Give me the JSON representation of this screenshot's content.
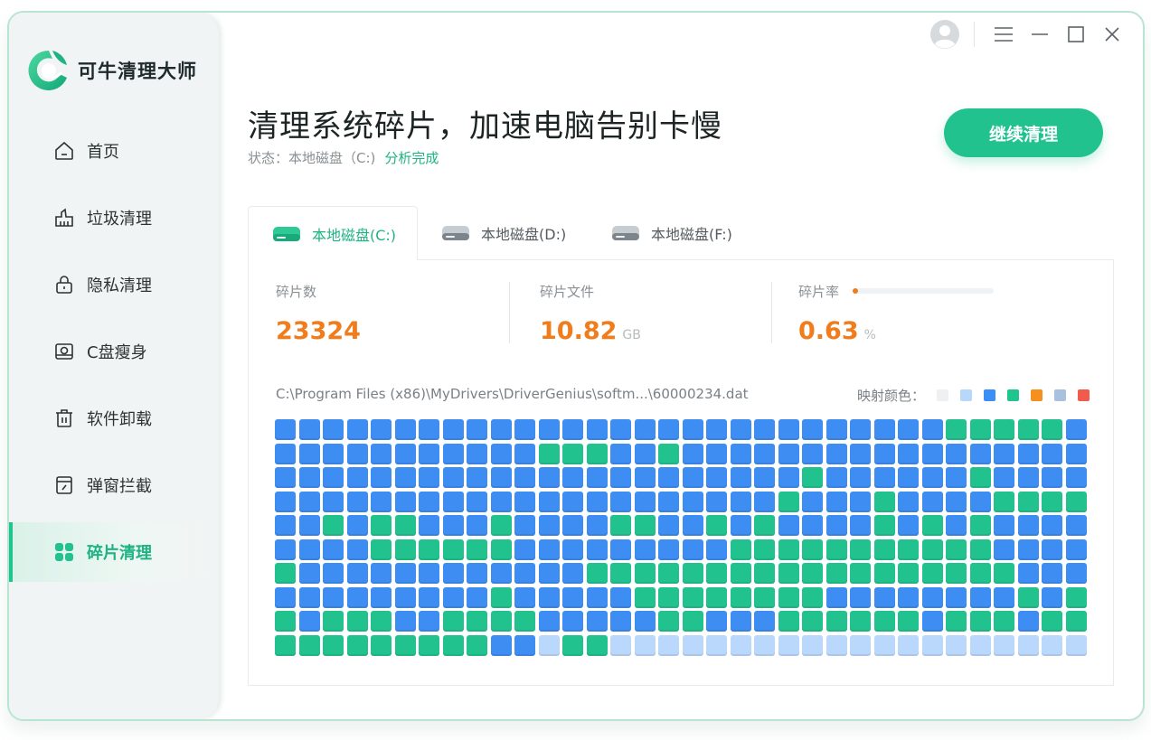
{
  "app": {
    "name": "可牛清理大师"
  },
  "sidebar": {
    "items": [
      {
        "label": "首页",
        "icon": "home-icon",
        "active": false
      },
      {
        "label": "垃圾清理",
        "icon": "trash-bin-icon",
        "active": false
      },
      {
        "label": "隐私清理",
        "icon": "lock-icon",
        "active": false
      },
      {
        "label": "C盘瘦身",
        "icon": "disk-slim-icon",
        "active": false
      },
      {
        "label": "软件卸载",
        "icon": "uninstall-icon",
        "active": false
      },
      {
        "label": "弹窗拦截",
        "icon": "popup-block-icon",
        "active": false
      },
      {
        "label": "碎片清理",
        "icon": "fragments-icon",
        "active": true
      }
    ]
  },
  "titlebar": {
    "icons": [
      "avatar-icon",
      "menu-icon",
      "minimize-icon",
      "maximize-icon",
      "close-icon"
    ]
  },
  "header": {
    "title": "清理系统碎片，加速电脑告别卡慢",
    "status_label": "状态：本地磁盘（C:)",
    "status_value": "分析完成",
    "button": "继续清理"
  },
  "tabs": [
    {
      "label": "本地磁盘(C:)",
      "active": true
    },
    {
      "label": "本地磁盘(D:)",
      "active": false
    },
    {
      "label": "本地磁盘(F:)",
      "active": false
    }
  ],
  "stats": {
    "count_label": "碎片数",
    "count_value": "23324",
    "files_label": "碎片文件",
    "files_value": "10.82",
    "files_unit": "GB",
    "rate_label": "碎片率",
    "rate_value": "0.63",
    "rate_unit": "%",
    "rate_fraction": 0.0063
  },
  "scan": {
    "path": "C:\\Program Files (x86)\\MyDrivers\\DriverGenius\\softm...\\60000234.dat",
    "legend_label": "映射颜色："
  },
  "colors": {
    "accent": "#22c28f",
    "legend": [
      "#eef0f1",
      "#b7d8fb",
      "#3a8ef5",
      "#1fc48f",
      "#f58f1d",
      "#a9c0de",
      "#f25b4c"
    ],
    "cell": {
      "B": "#3d8df2",
      "G": "#22c28f",
      "L": "#b9d8fb"
    }
  },
  "grid": {
    "rows": [
      "BBBBBBBBBBBBBBBBBBBBBBBBBBBBGGGGGB",
      "BBBBBBBBBBBGGGBBGBBBBBBBBBBBBBBBBB",
      "BBBBBBBBBBBBBBBBBBBBBBGBBBBBBGBBBB",
      "BBBBBBBBBBBBBBBBBBBBBGBBBGBBBBGGGG",
      "BBGBGGBBBGBBBBGGBBGBGBBBBGBGBGBBBB",
      "BBBBGGGGGGBBBBBBBBBGGGGGGGGGGGBBBB",
      "GBBBBBBBBBBBBGGGGGGGGGGGGGGGGGGBBB",
      "BBBBBBBBBGBBBBBGGGGGGGGBBBBBBBBGBG",
      "GBGGGBBGGGGBBBBBGGBBBGGGGGGBGGGBGG",
      "GGGGGGGGGBBLGGLLLLLLLLLLLLLLLLLLLL"
    ]
  }
}
